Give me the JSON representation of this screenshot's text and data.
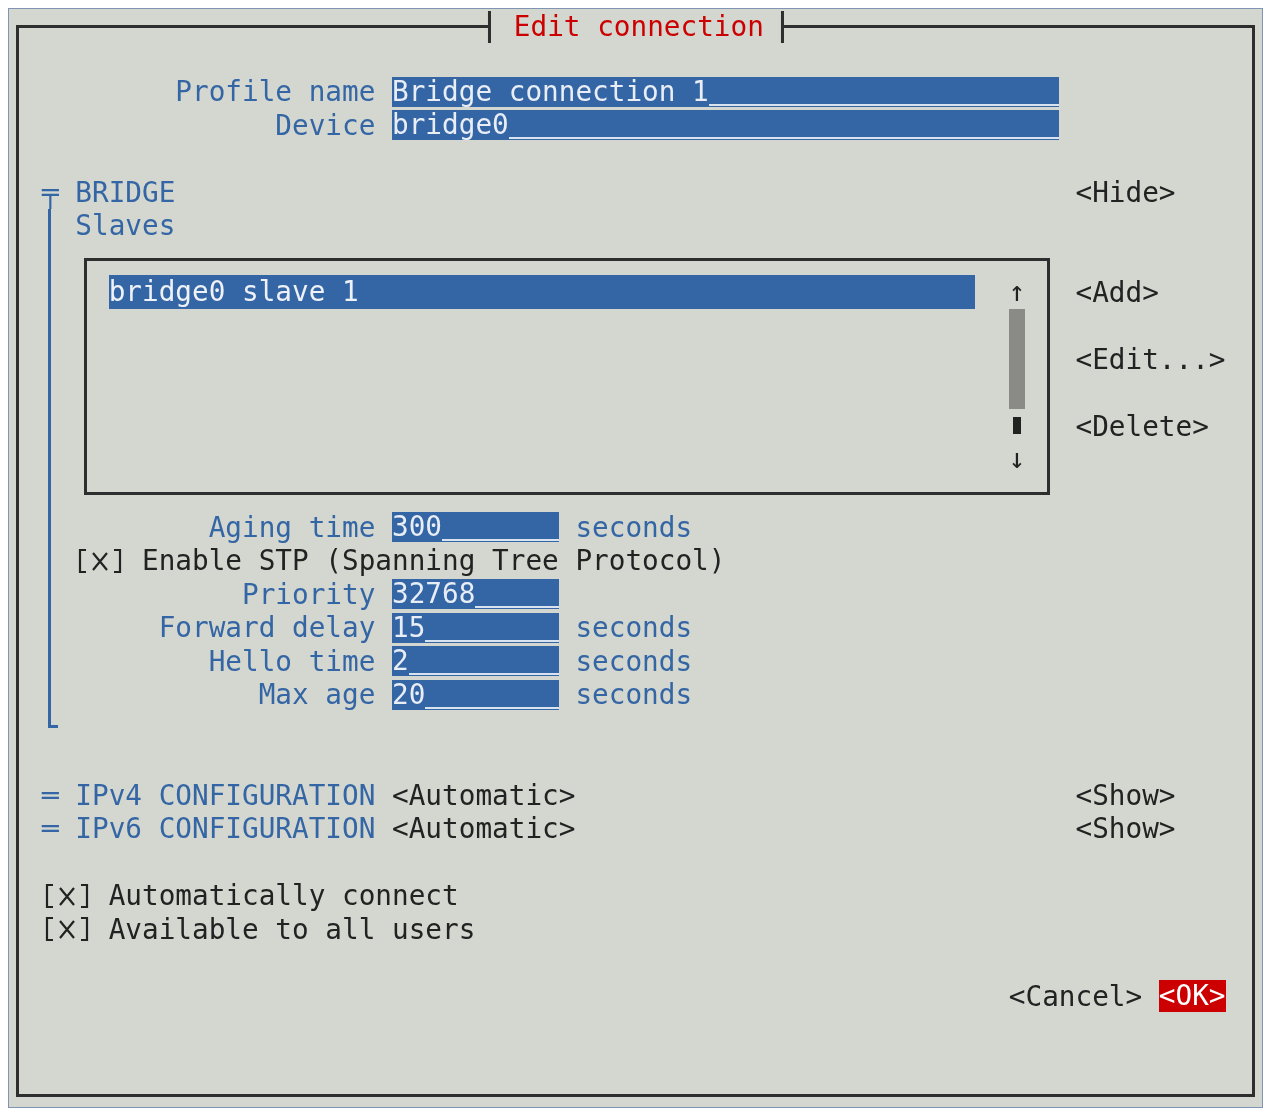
{
  "window": {
    "title": "Edit connection"
  },
  "profile": [
    {
      "label": "Profile name",
      "value": "Bridge connection 1"
    },
    {
      "label": "Device",
      "value": "bridge0"
    }
  ],
  "bridge": {
    "marker": "╤",
    "title": "BRIDGE",
    "toggle": "<Hide>",
    "slaves": {
      "label": "Slaves",
      "items": [
        {
          "text": "bridge0 slave 1",
          "selected": true
        }
      ],
      "scroll_up": "↑",
      "scroll_down": "↓",
      "buttons": [
        "<Add>",
        "<Edit...>",
        "<Delete>"
      ]
    },
    "settings": [
      {
        "kind": "field",
        "label": "Aging time",
        "value": "300",
        "unit": "seconds"
      },
      {
        "kind": "checkbox",
        "label": "Enable STP (Spanning Tree Protocol)",
        "checked": true
      },
      {
        "kind": "field",
        "label": "Priority",
        "value": "32768"
      },
      {
        "kind": "field",
        "label": "Forward delay",
        "value": "15",
        "unit": "seconds"
      },
      {
        "kind": "field",
        "label": "Hello time",
        "value": "2",
        "unit": "seconds"
      },
      {
        "kind": "field",
        "label": "Max age",
        "value": "20",
        "unit": "seconds"
      }
    ]
  },
  "ip_sections": [
    {
      "marker": "═",
      "title": "IPv4 CONFIGURATION",
      "value": "<Automatic>",
      "toggle": "<Show>"
    },
    {
      "marker": "═",
      "title": "IPv6 CONFIGURATION",
      "value": "<Automatic>",
      "toggle": "<Show>"
    }
  ],
  "options": [
    {
      "label": "Automatically connect",
      "checked": true
    },
    {
      "label": "Available to all users",
      "checked": true
    }
  ],
  "buttons": [
    {
      "label": "<Cancel>",
      "focused": false
    },
    {
      "label": "<OK>",
      "focused": true
    }
  ]
}
